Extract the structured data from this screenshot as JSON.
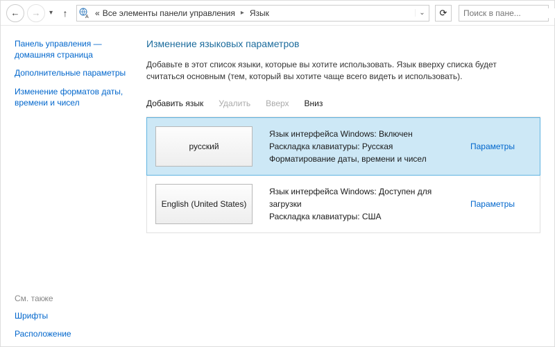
{
  "address": {
    "prefix": "«",
    "path1": "Все элементы панели управления",
    "path2": "Язык"
  },
  "search": {
    "placeholder": "Поиск в пане..."
  },
  "sidebar": {
    "home": "Панель управления — домашняя страница",
    "advanced": "Дополнительные параметры",
    "formats": "Изменение форматов даты, времени и чисел",
    "see_also": "См. также",
    "fonts": "Шрифты",
    "location": "Расположение"
  },
  "main": {
    "heading": "Изменение языковых параметров",
    "desc": "Добавьте в этот список языки, которые вы хотите использовать. Язык вверху списка будет считаться основным (тем, который вы хотите чаще всего видеть и использовать).",
    "toolbar": {
      "add": "Добавить язык",
      "remove": "Удалить",
      "up": "Вверх",
      "down": "Вниз"
    },
    "opt_label": "Параметры",
    "langs": [
      {
        "name": "русский",
        "line1": "Язык интерфейса Windows: Включен",
        "line2": "Раскладка клавиатуры: Русская",
        "line3": "Форматирование даты, времени и чисел",
        "selected": true
      },
      {
        "name": "English (United States)",
        "line1": "Язык интерфейса Windows: Доступен для загрузки",
        "line2": "Раскладка клавиатуры: США",
        "line3": "",
        "selected": false
      }
    ]
  }
}
